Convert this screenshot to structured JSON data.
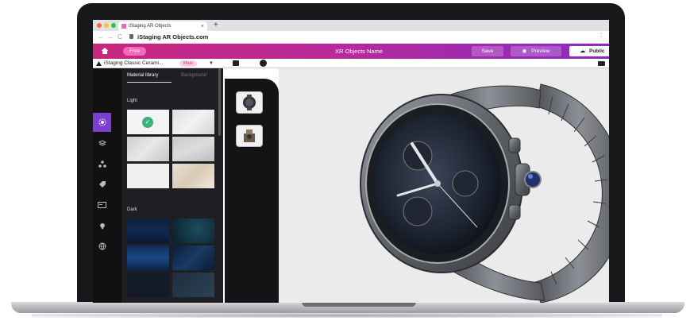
{
  "browser": {
    "tab_title": "iStaging AR Objects",
    "tab_close": "×",
    "new_tab": "+",
    "nav_back": "←",
    "nav_forward": "→",
    "nav_reload": "C",
    "url": "iStaging AR Objects.com",
    "menu": "⋮",
    "traffic_colors": [
      "#ff5f57",
      "#febc2e",
      "#28c840"
    ]
  },
  "header": {
    "free_label": "Free",
    "title": "XR Objects Name",
    "save_label": "Save",
    "preview_label": "Preview",
    "public_label": "Public",
    "gradient_start": "#c8277e",
    "gradient_end": "#8a2bc2"
  },
  "object_bar": {
    "name": "iStaging Classic Cerami...",
    "badge": "Main",
    "caret": "▼"
  },
  "rail": {
    "icons": [
      "material-icon",
      "layers-icon",
      "nodes-icon",
      "tag-icon",
      "card-icon",
      "pin-icon",
      "globe-icon"
    ]
  },
  "panel": {
    "tabs": [
      {
        "label": "Material library"
      },
      {
        "label": "Background"
      }
    ],
    "light_label": "Light",
    "dark_label": "Dark",
    "selected_mark": "✓"
  },
  "accent_color": "#7a3fd0"
}
